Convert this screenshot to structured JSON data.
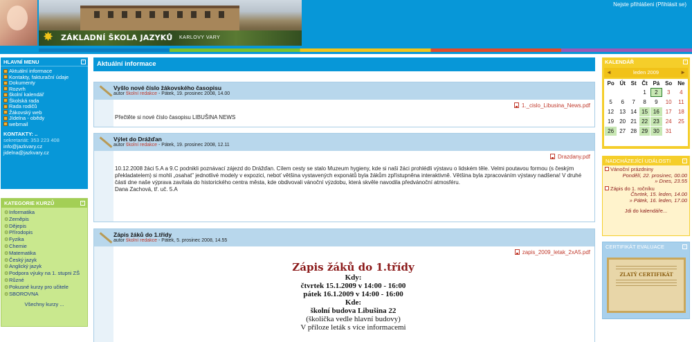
{
  "header": {
    "logo_title": "ZÁKLADNÍ ŠKOLA JAZYKŮ",
    "logo_subtitle": "KARLOVY VARY",
    "login_info": "Nejste přihlášeni (Přihlásit se)"
  },
  "main_menu": {
    "title": "HLAVNÍ MENU",
    "items": [
      {
        "label": "Aktuální informace"
      },
      {
        "label": "Kontakty, fakturační údaje"
      },
      {
        "label": "Dokumenty"
      },
      {
        "label": "Rozvrh"
      },
      {
        "label": "školní kalendář"
      },
      {
        "label": "Školská rada"
      },
      {
        "label": "Rada rodičů"
      },
      {
        "label": "Žákovský web"
      },
      {
        "label": "Jídelna - obědy"
      },
      {
        "label": "webmail"
      }
    ],
    "contacts_heading": "KONTAKTY: ..",
    "phone": "sekretariát: 353 223 408",
    "email1": "info@jazkvary.cz",
    "email2": "jidelna@jazkvary.cz"
  },
  "courses": {
    "title": "KATEGORIE KURZŮ",
    "items": [
      "Informatika",
      "Zeměpis",
      "Dějepis",
      "Přírodopis",
      "Fyzika",
      "Chemie",
      "Matematika",
      "Český jazyk",
      "Anglický jazyk",
      "Podpora výuky na 1. stupni ZŠ",
      "Různé",
      "Pokusné kurzy pro učitele",
      "SBOROVNA"
    ],
    "more": "Všechny kurzy ..."
  },
  "center": {
    "title": "Aktuální informace",
    "posts": [
      {
        "title": "Vyšlo nové číslo žákovského časopisu",
        "meta_prefix": "autor",
        "author": "školní redakce",
        "date": " - Pátek, 19. prosinec 2008, 14.00",
        "attachment": "1._cislo_Libusina_News.pdf",
        "body": "Přečtěte si nové číslo časopisu LIBUŠINA NEWS"
      },
      {
        "title": "Výlet do Drážďan",
        "meta_prefix": "autor",
        "author": "školní redakce",
        "date": " - Pátek, 19. prosinec 2008, 12.11",
        "attachment": "Drazdany.pdf",
        "body": "10.12.2008 žáci 5.A a 9.C podnikli poznávací zájezd do Drážďan. Cílem cesty se stalo Muzeum hygieny, kde si naši žáci prohlédli výstavu o lidském těle. Velmi poutavou formou (s českým překladatelem) si mohli „osahat\" jednotlivé modely v expozici, neboť většina vystavených exponátů byla žákům zpřístupněna interaktivně. Většina byla zpracováním výstavy nadšena! V druhé části dne naše výprava zavítala do historického centra města, kde obdivovali vánoční výzdobu, která skvěle navodila předvánoční atmosféru.",
        "signature": "Dana Zachová, tř. uč. 5.A"
      },
      {
        "title": "Zápis žáků do 1.třídy",
        "meta_prefix": "autor",
        "author": "školní redakce",
        "date": " - Pátek, 5. prosinec 2008, 14.55",
        "attachment": "zapis_2009_letak_2xA5.pdf",
        "heading": "Zápis žáků do 1.třídy",
        "lines": [
          "Kdy:",
          "čtvrtek 15.1.2009 v 14:00 - 16:00",
          "pátek 16.1.2009 v 14:00 - 16:00",
          "Kde:",
          "školní budova Libušina 22",
          "(školička vedle hlavní budovy)",
          "V příloze leták s více informacemi"
        ]
      }
    ]
  },
  "calendar": {
    "title": "KALENDÁŘ",
    "month": "leden 2009",
    "prev": "◄",
    "next": "►",
    "weekdays": [
      "Po",
      "Út",
      "St",
      "Čt",
      "Pá",
      "So",
      "Ne"
    ]
  },
  "events": {
    "title": "NADCHÁZEJÍCÍ UDÁLOSTI",
    "items": [
      {
        "title": "Vánoční prázdniny",
        "from": "Pondělí, 22. prosinec, 00.00",
        "to": "» Dnes, 23.55"
      },
      {
        "title": "Zápis do 1. ročníku",
        "from": "Čtvrtek, 15. leden, 14.00",
        "to": "» Pátek, 16. leden, 17.00"
      }
    ],
    "all_link": "Jdi do kalendáře..."
  },
  "certificate": {
    "title": "CERTIFIKÁT EVALUACE",
    "cert_title": "ZLATÝ CERTIFIKÁT"
  },
  "colors": {
    "header_blue": "#0797d8",
    "course_green": "#c9e88e",
    "calendar_yellow": "#f5ce2a",
    "link_red": "#c0392b"
  }
}
